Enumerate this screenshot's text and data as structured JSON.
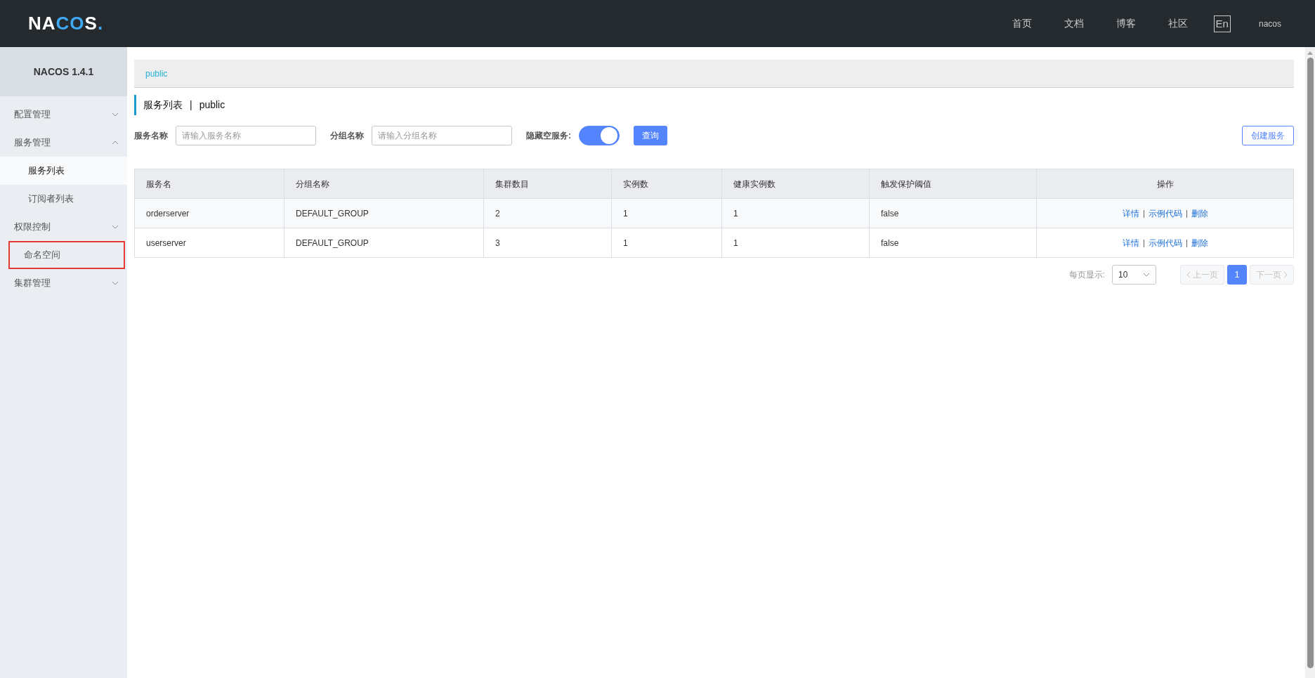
{
  "header": {
    "logo": "NACOS.",
    "nav": [
      "首页",
      "文档",
      "博客",
      "社区"
    ],
    "language": "En",
    "user": "nacos"
  },
  "sidebar": {
    "title": "NACOS 1.4.1",
    "items": [
      {
        "label": "配置管理",
        "kind": "group",
        "expanded": false,
        "selected": false,
        "highlighted": false
      },
      {
        "label": "服务管理",
        "kind": "group",
        "expanded": true,
        "selected": false,
        "highlighted": false,
        "children": [
          {
            "label": "服务列表",
            "kind": "sub",
            "selected": true,
            "highlighted": false
          },
          {
            "label": "订阅者列表",
            "kind": "sub",
            "selected": false,
            "highlighted": false
          }
        ]
      },
      {
        "label": "权限控制",
        "kind": "group",
        "expanded": false,
        "selected": false,
        "highlighted": false
      },
      {
        "label": "命名空间",
        "kind": "link",
        "selected": false,
        "highlighted": true
      },
      {
        "label": "集群管理",
        "kind": "group",
        "expanded": false,
        "selected": false,
        "highlighted": false
      }
    ]
  },
  "namespace_bar": {
    "namespaces": [
      {
        "label": "public",
        "selected": true
      }
    ]
  },
  "page_title": {
    "title": "服务列表",
    "separator": "|",
    "namespace": "public"
  },
  "filters": {
    "service_name": {
      "label": "服务名称",
      "placeholder": "请输入服务名称"
    },
    "group_name": {
      "label": "分组名称",
      "placeholder": "请输入分组名称"
    },
    "hide_empty": {
      "label": "隐藏空服务:",
      "on": true
    },
    "query_button": "查询",
    "create_button": "创建服务"
  },
  "table": {
    "columns": [
      "服务名",
      "分组名称",
      "集群数目",
      "实例数",
      "健康实例数",
      "触发保护阈值",
      "操作"
    ],
    "rows": [
      {
        "cells": [
          "orderserver",
          "DEFAULT_GROUP",
          "2",
          "1",
          "1",
          "false"
        ],
        "actions": [
          "详情",
          "示例代码",
          "删除"
        ]
      },
      {
        "cells": [
          "userserver",
          "DEFAULT_GROUP",
          "3",
          "1",
          "1",
          "false"
        ],
        "actions": [
          "详情",
          "示例代码",
          "删除"
        ]
      }
    ]
  },
  "pagination": {
    "page_size_label": "每页显示:",
    "page_size": "10",
    "prev": "上一页",
    "next": "下一页",
    "pages": [
      {
        "label": "1",
        "selected": true
      }
    ],
    "prev_disabled": true,
    "next_disabled": true
  }
}
